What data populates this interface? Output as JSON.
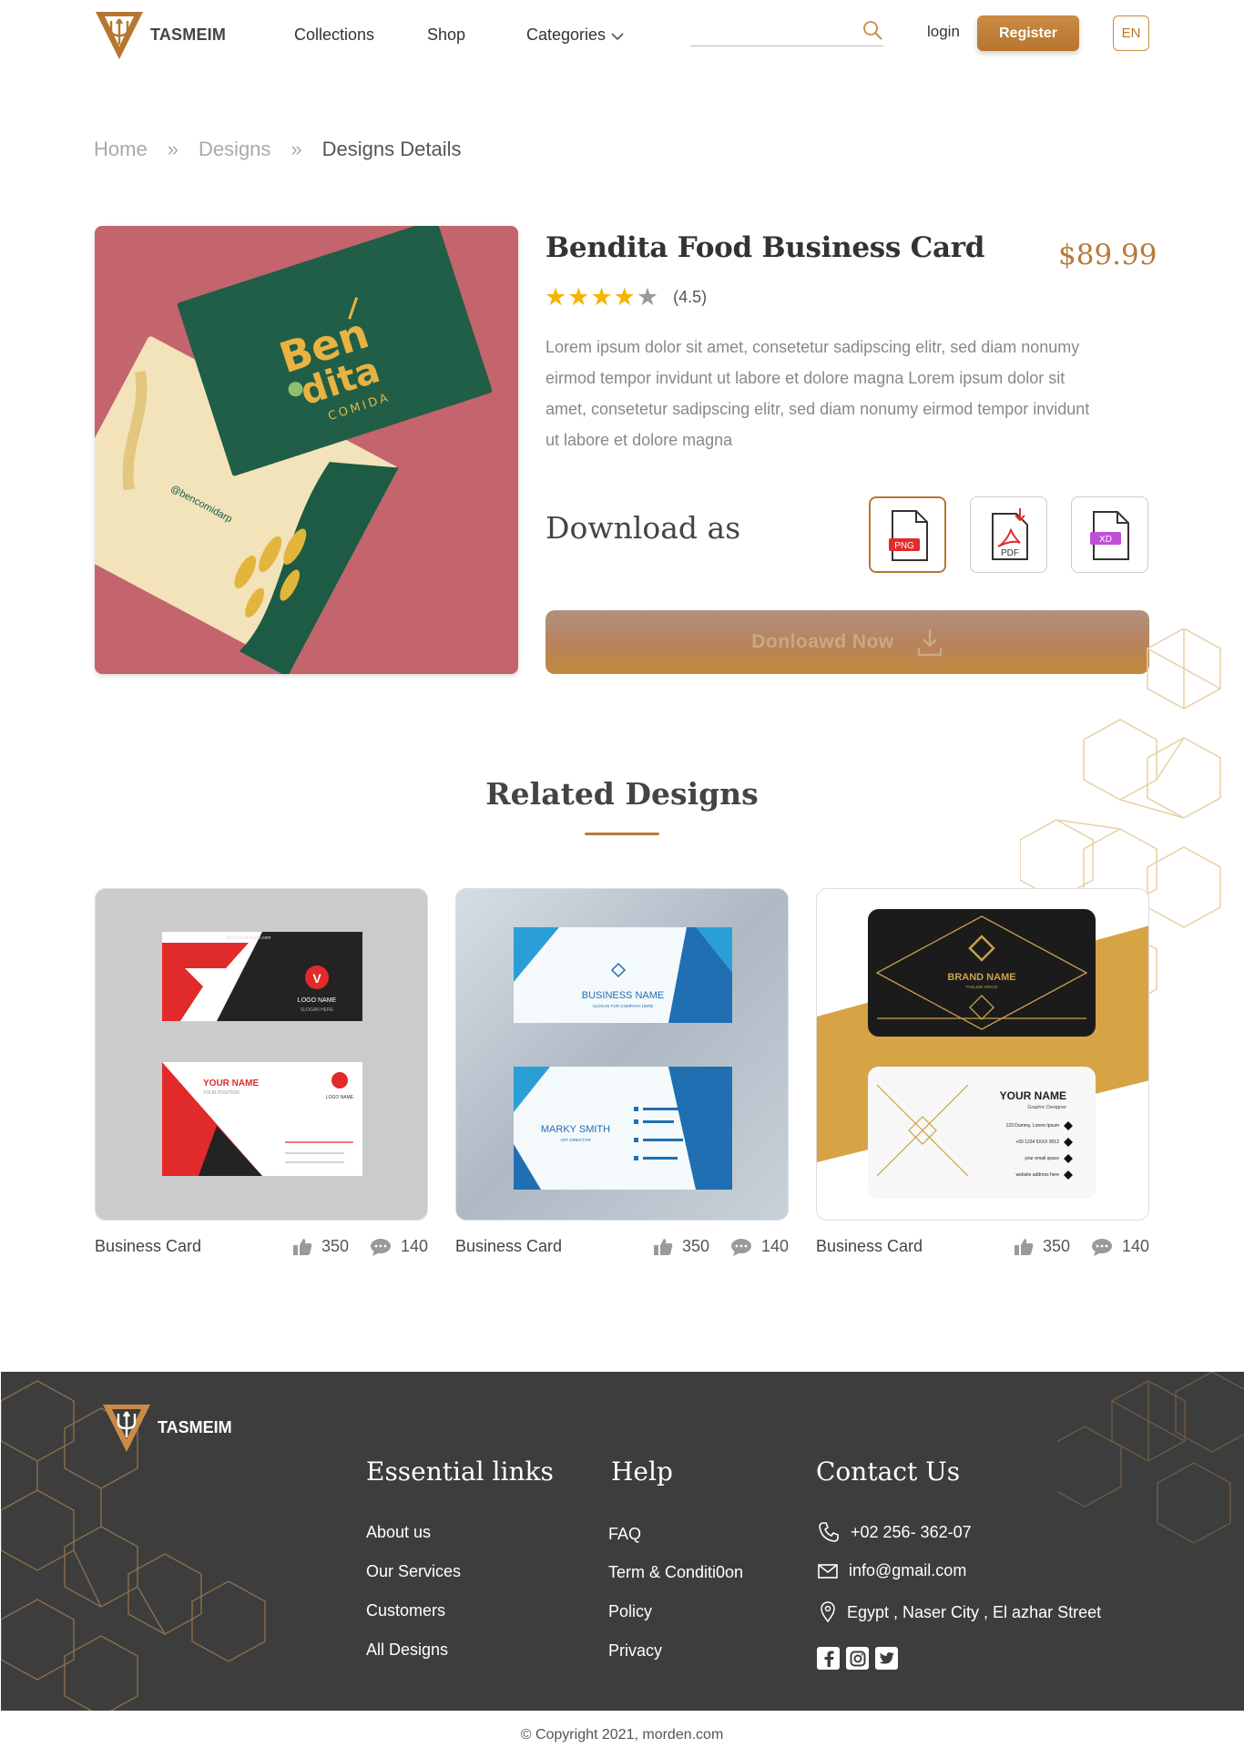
{
  "header": {
    "brand": "TASMEIM",
    "nav": [
      "Collections",
      "Shop",
      "Categories"
    ],
    "search_placeholder": "",
    "login": "login",
    "register": "Register",
    "lang": "EN"
  },
  "breadcrumb": [
    "Home",
    "Designs",
    "Designs Details"
  ],
  "product": {
    "title": "Bendita Food Business Card",
    "price": "$89.99",
    "rating": 4.5,
    "rating_text": "(4.5)",
    "description": "Lorem ipsum dolor sit amet, consetetur sadipscing elitr, sed diam nonumy eirmod tempor invidunt ut labore et dolore magna Lorem ipsum dolor sit amet, consetetur sadipscing elitr, sed diam nonumy eirmod tempor invidunt ut labore et dolore magna",
    "download_label": "Download as",
    "formats": [
      "PNG",
      "PDF",
      "XD"
    ],
    "selected_format": "PNG",
    "download_button": "Donloawd  Now",
    "image_text": {
      "line1": "Ben",
      "line2": "dita",
      "line3": "COMIDA",
      "back": "@bencomidarp"
    }
  },
  "related": {
    "title": "Related Designs",
    "cards": [
      {
        "title": "Business Card",
        "likes": "350",
        "comments": "140",
        "art": {
          "front_site": "www.yourwebsite.com",
          "front_logo": "LOGO NAME",
          "front_slogan": "SLOGAN HERE",
          "back_name": "YOUR NAME",
          "back_position": "YOUR POSITION",
          "back_logo": "LOGO NAME"
        }
      },
      {
        "title": "Business Card",
        "likes": "350",
        "comments": "140",
        "art": {
          "front_name": "BUSINESS NAME",
          "front_slogan": "SLOGAN FOR COMPANY HERE",
          "back_name": "MARKY SMITH",
          "back_role": "ART DIRECTOR"
        }
      },
      {
        "title": "Business Card",
        "likes": "350",
        "comments": "140",
        "art": {
          "front_name": "BRAND NAME",
          "front_tag": "TAGLINE SPACE",
          "back_name": "YOUR NAME",
          "back_role": "Graphic Designer",
          "back_lines": [
            "123 Dummy, Lorem Ipsum",
            "+00 1234 5XXX 9012",
            "your email space",
            "website address here"
          ]
        }
      }
    ]
  },
  "footer": {
    "brand": "TASMEIM",
    "essential": {
      "heading": "Essential links",
      "links": [
        "About us",
        "Our Services",
        "Customers",
        "All Designs"
      ]
    },
    "help": {
      "heading": "Help",
      "links": [
        "FAQ",
        "Term & Conditi0on",
        "Policy",
        "Privacy"
      ]
    },
    "contact": {
      "heading": "Contact Us",
      "phone": "+02 256- 362-07",
      "email": "info@gmail.com",
      "address": "Egypt , Naser City , El azhar Street"
    },
    "social": [
      "facebook-icon",
      "instagram-icon",
      "twitter-icon"
    ]
  },
  "copyright": "© Copyright 2021, morden.com",
  "colors": {
    "accent": "#b87a3a",
    "star": "#f5b400",
    "footer_bg": "#3d3d3d"
  }
}
